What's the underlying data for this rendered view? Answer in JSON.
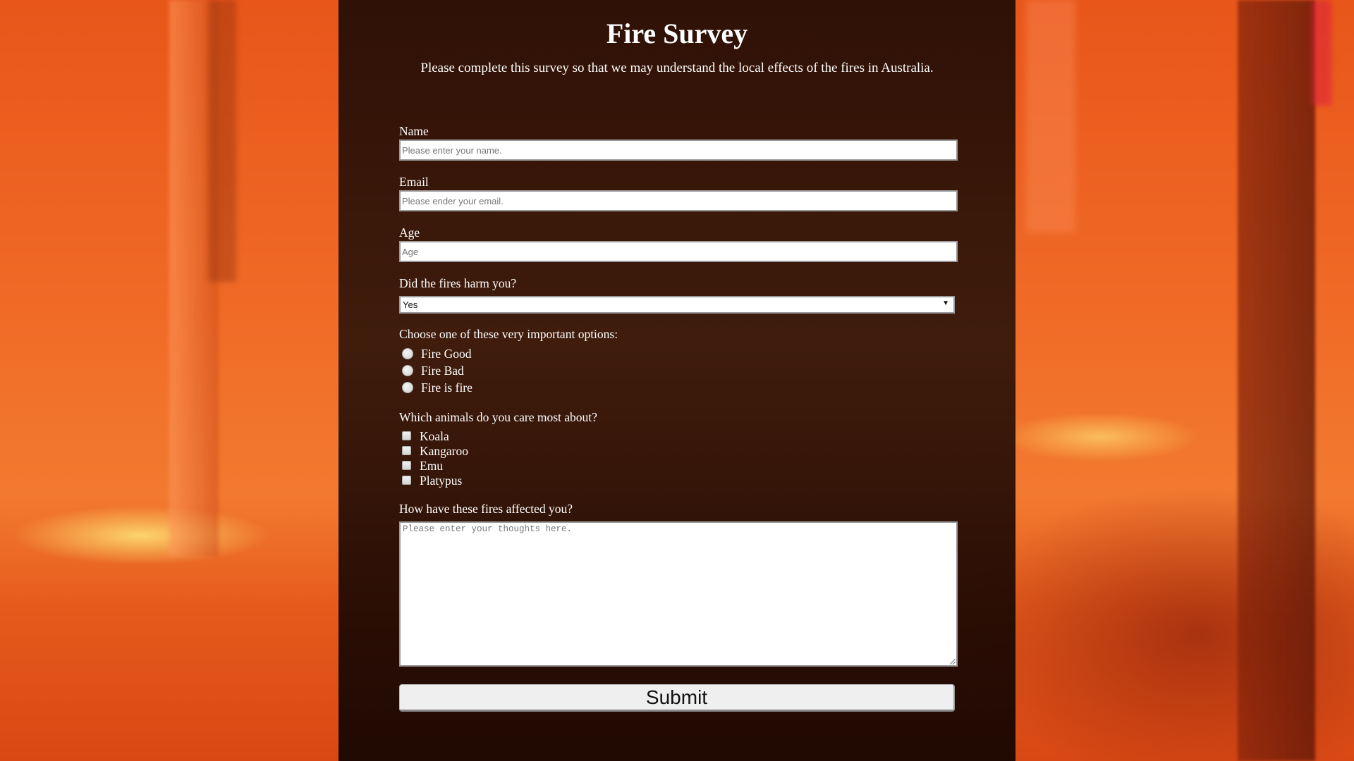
{
  "header": {
    "title": "Fire Survey",
    "description": "Please complete this survey so that we may understand the local effects of the fires in Australia."
  },
  "form": {
    "name": {
      "label": "Name",
      "placeholder": "Please enter your name.",
      "value": ""
    },
    "email": {
      "label": "Email",
      "placeholder": "Please ender your email.",
      "value": ""
    },
    "age": {
      "label": "Age",
      "placeholder": "Age",
      "value": ""
    },
    "harm": {
      "label": "Did the fires harm you?",
      "selected": "Yes"
    },
    "options": {
      "label": "Choose one of these very important options:",
      "items": [
        "Fire Good",
        "Fire Bad",
        "Fire is fire"
      ]
    },
    "animals": {
      "label": "Which animals do you care most about?",
      "items": [
        "Koala",
        "Kangaroo",
        "Emu",
        "Platypus"
      ]
    },
    "comments": {
      "label": "How have these fires affected you?",
      "placeholder": "Please enter your thoughts here.",
      "value": ""
    },
    "submit_label": "Submit"
  },
  "icons": {
    "select_arrow": "▼"
  },
  "colors": {
    "panel_bg": "#2a0f05",
    "text": "#ffffff",
    "button_bg": "#efefef"
  }
}
